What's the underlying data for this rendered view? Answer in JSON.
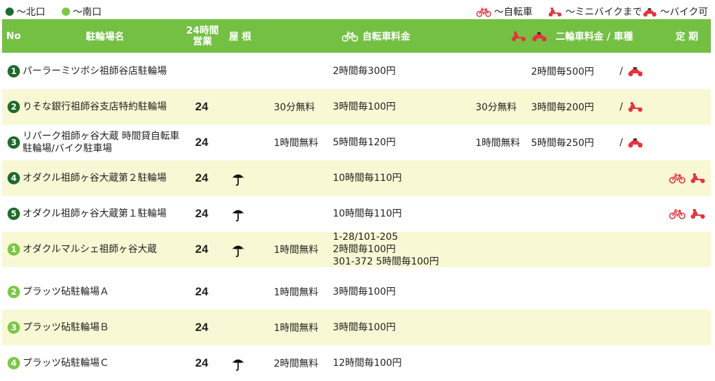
{
  "legend": {
    "north": "～北口",
    "south": "～南口",
    "bicycle": "～自転車",
    "minibike": "～ミニバイクまで",
    "bike": "～バイク可"
  },
  "header": {
    "no": "No",
    "name": "駐輪場名",
    "hours_line1": "24時間",
    "hours_line2": "営業",
    "roof": "屋 根",
    "bicycle_fee": "自転車料金",
    "moto_fee": "二輪車料金 / 車種",
    "season": "定 期"
  },
  "colors": {
    "header_bg": "#74c043",
    "row_alt_bg": "#f8f8d4",
    "north_badge": "#1d6b2c",
    "south_badge": "#7ac943",
    "vehicle_red": "#e8323c"
  },
  "rows": [
    {
      "num": "1",
      "exit": "north",
      "name": "パーラーミツボシ祖師谷店駐輪場",
      "hours24": "",
      "roof": false,
      "free_bicycle": "",
      "fee_bicycle": "2時間毎300円",
      "free_moto": "",
      "fee_moto": "2時間毎500円",
      "moto_type_sep": "/",
      "moto_type": "bike",
      "season": []
    },
    {
      "num": "2",
      "exit": "north",
      "name": "りそな銀行祖師谷支店特約駐輪場",
      "hours24": "24",
      "roof": false,
      "free_bicycle": "30分無料",
      "fee_bicycle": "3時間毎100円",
      "free_moto": "30分無料",
      "fee_moto": "3時間毎200円",
      "moto_type_sep": "/",
      "moto_type": "minibike",
      "season": []
    },
    {
      "num": "3",
      "exit": "north",
      "name": "リパーク祖師ヶ谷大蔵 時間貸自転車駐輪場/バイク駐車場",
      "hours24": "24",
      "roof": false,
      "free_bicycle": "1時間無料",
      "fee_bicycle": "5時間毎120円",
      "free_moto": "1時間無料",
      "fee_moto": "5時間毎250円",
      "moto_type_sep": "/",
      "moto_type": "bike",
      "season": []
    },
    {
      "num": "4",
      "exit": "north",
      "name": "オダクル祖師ヶ谷大蔵第２駐輪場",
      "hours24": "24",
      "roof": true,
      "free_bicycle": "",
      "fee_bicycle": "10時間毎110円",
      "free_moto": "",
      "fee_moto": "",
      "moto_type_sep": "",
      "moto_type": "",
      "season": [
        "bicycle",
        "minibike"
      ]
    },
    {
      "num": "5",
      "exit": "north",
      "name": "オダクル祖師ヶ谷大蔵第１駐輪場",
      "hours24": "24",
      "roof": true,
      "free_bicycle": "",
      "fee_bicycle": "10時間毎110円",
      "free_moto": "",
      "fee_moto": "",
      "moto_type_sep": "",
      "moto_type": "",
      "season": [
        "bicycle",
        "minibike"
      ]
    },
    {
      "num": "1",
      "exit": "south",
      "name": "オダクルマルシェ祖師ヶ谷大蔵",
      "hours24": "24",
      "roof": true,
      "free_bicycle": "1時間無料",
      "fee_bicycle_lines": [
        "1-28/101-205",
        "2時間毎100円",
        "301-372 5時間毎100円"
      ],
      "free_moto": "",
      "fee_moto": "",
      "moto_type_sep": "",
      "moto_type": "",
      "season": []
    },
    {
      "num": "2",
      "exit": "south",
      "name": "プラッツ砧駐輪場Ａ",
      "hours24": "24",
      "roof": false,
      "free_bicycle": "1時間無料",
      "fee_bicycle": "3時間毎100円",
      "free_moto": "",
      "fee_moto": "",
      "moto_type_sep": "",
      "moto_type": "",
      "season": []
    },
    {
      "num": "3",
      "exit": "south",
      "name": "プラッツ砧駐輪場Ｂ",
      "hours24": "24",
      "roof": false,
      "free_bicycle": "1時間無料",
      "fee_bicycle": "3時間毎100円",
      "free_moto": "",
      "fee_moto": "",
      "moto_type_sep": "",
      "moto_type": "",
      "season": []
    },
    {
      "num": "4",
      "exit": "south",
      "name": "プラッツ砧駐輪場Ｃ",
      "hours24": "24",
      "roof": true,
      "free_bicycle": "2時間無料",
      "fee_bicycle": "12時間毎100円",
      "free_moto": "",
      "fee_moto": "",
      "moto_type_sep": "",
      "moto_type": "",
      "season": []
    }
  ]
}
